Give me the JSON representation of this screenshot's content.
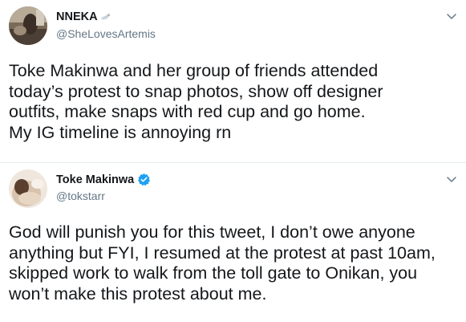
{
  "tweets": [
    {
      "display_name": "NNEKA",
      "name_emoji": "dove-emoji",
      "handle": "@SheLovesArtemis",
      "verified": false,
      "text_lines": [
        "Toke Makinwa and her group of friends attended",
        "today’s protest to snap photos, show off designer",
        "outfits, make snaps with red cup and go home.",
        "My IG timeline is annoying rn"
      ]
    },
    {
      "display_name": "Toke Makinwa",
      "handle": "@tokstarr",
      "verified": true,
      "text_lines": [
        "God will punish you for this tweet, I don’t owe anyone",
        "anything but FYI, I resumed at the protest at past 10am,",
        "skipped work to walk from  the toll gate to Onikan, you",
        "won’t make this protest about me."
      ]
    }
  ],
  "colors": {
    "text": "#14171a",
    "secondary": "#657786",
    "verified": "#1da1f2",
    "divider": "#e6ecf0"
  }
}
